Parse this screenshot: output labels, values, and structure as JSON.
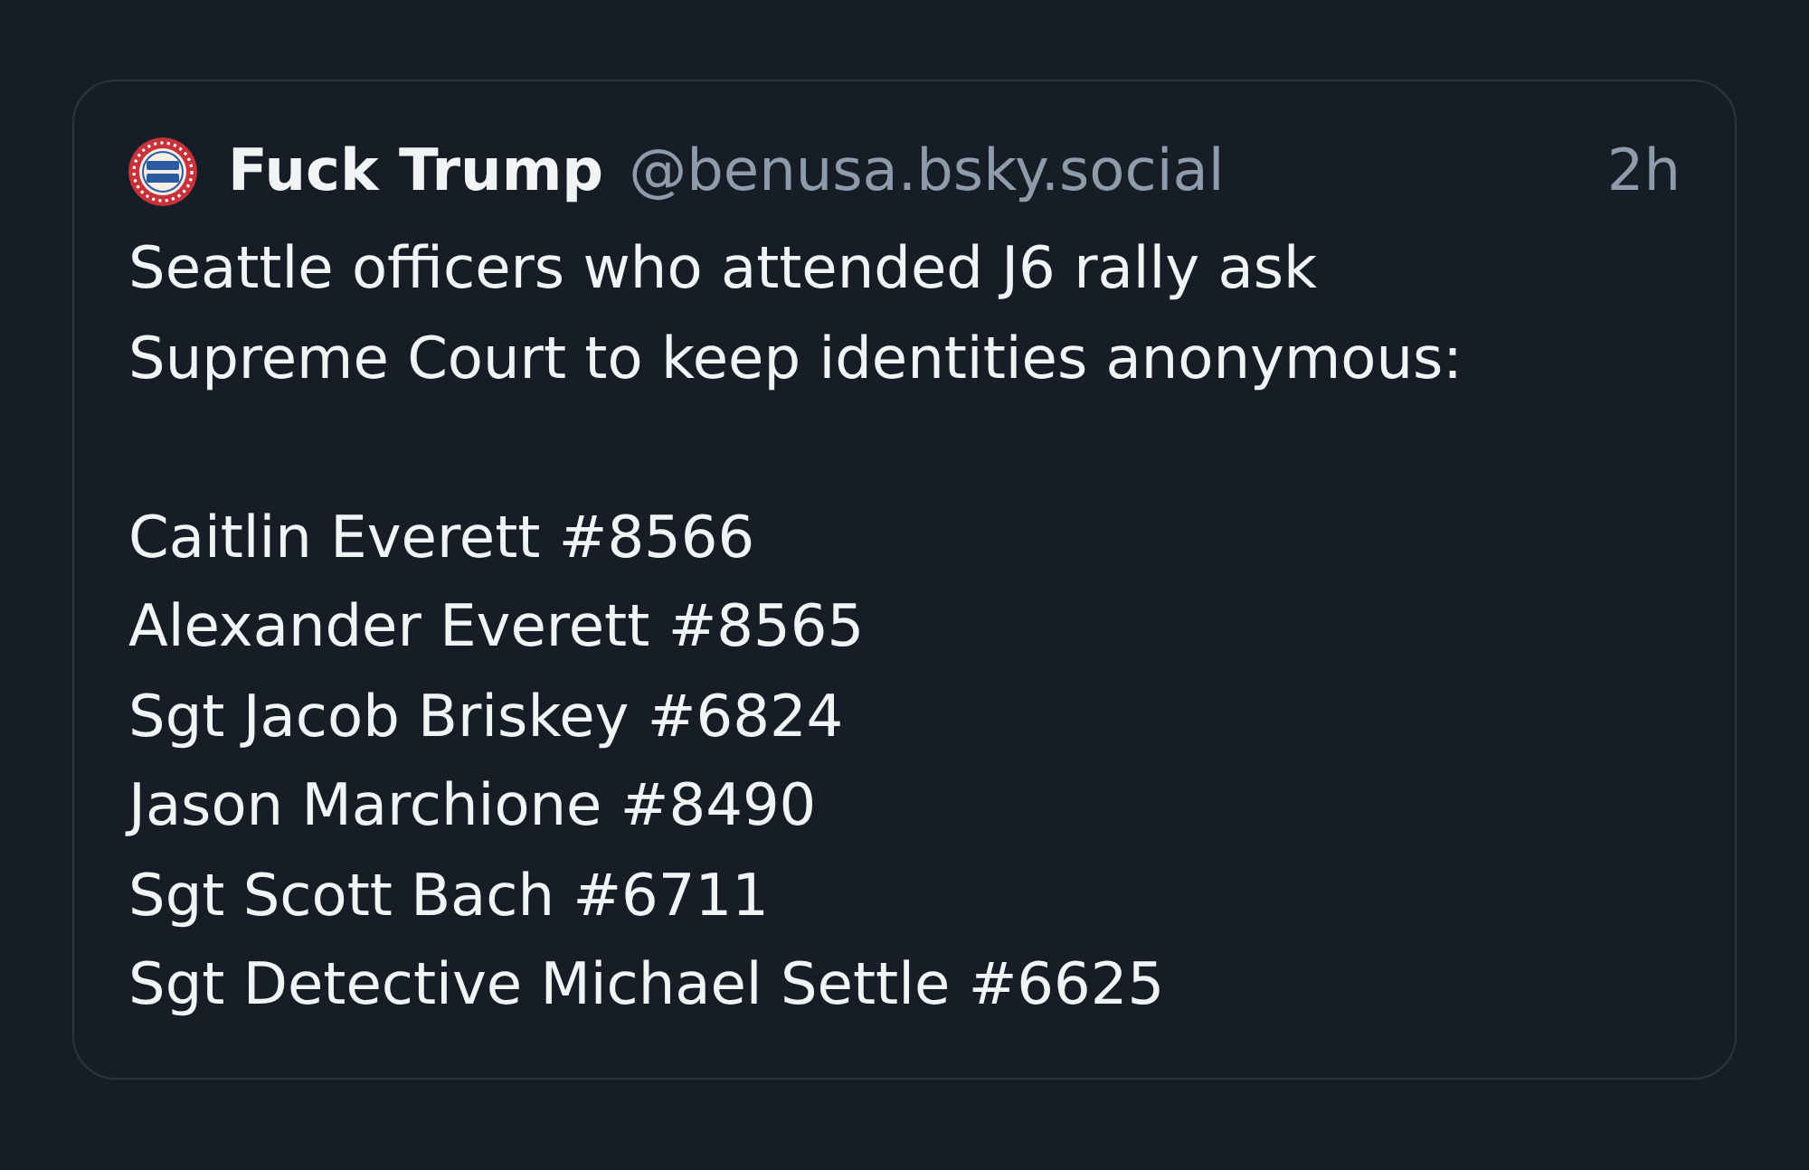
{
  "post": {
    "author": "Fuck Trump",
    "handle": "@benusa.bsky.social",
    "time": "2h",
    "paragraphs": [
      "Seattle officers who attended J6 rally ask Supreme Court to keep identities anonymous:"
    ],
    "names": [
      "Caitlin Everett #8566",
      "Alexander Everett #8565",
      "Sgt Jacob Briskey #6824",
      "Jason Marchione #8490",
      "Sgt Scott Bach #6711",
      "Sgt Detective Michael Settle #6625"
    ]
  }
}
